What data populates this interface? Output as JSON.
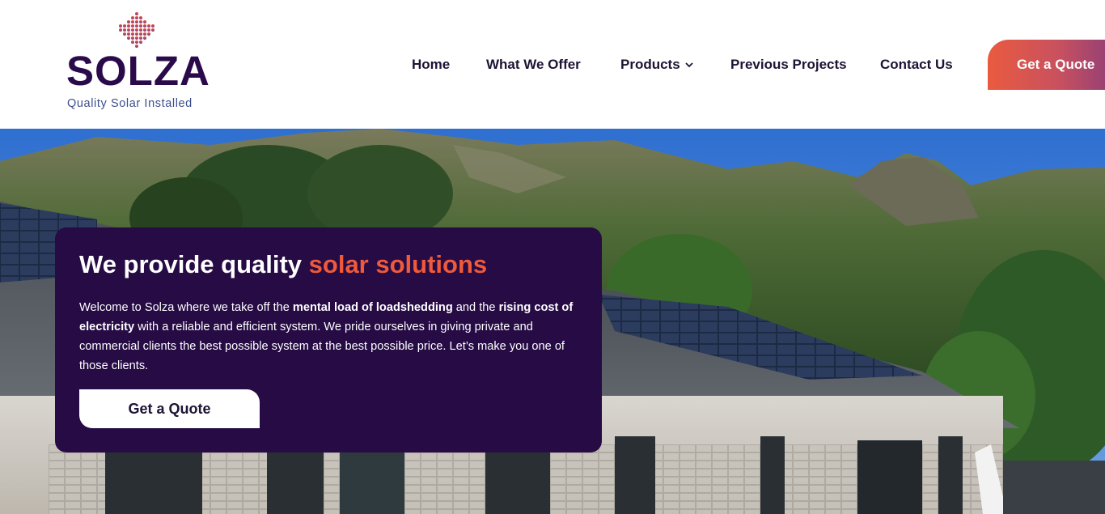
{
  "brand": {
    "name": "SOLZA",
    "tagline": "Quality Solar Installed",
    "primary_color": "#2a0a4a",
    "accent_color": "#ee5a3a"
  },
  "nav": {
    "items": [
      {
        "label": "Home"
      },
      {
        "label": "What We Offer"
      },
      {
        "label": "Products",
        "has_dropdown": true,
        "icon": "chevron-down-icon"
      },
      {
        "label": "Previous Projects"
      },
      {
        "label": "Contact Us"
      }
    ],
    "cta_label": "Get a Quote"
  },
  "hero": {
    "title_plain": "We provide quality ",
    "title_accent": "solar solutions",
    "body": {
      "p1": "Welcome to Solza where we take off the ",
      "b1": "mental load of loadshedding",
      "p2": " and the ",
      "b2": "rising cost of electricity",
      "p3": " with a reliable and efficient system. We pride ourselves in giving private and commercial clients the best possible system at the best possible price. Let’s make you one of those clients."
    },
    "cta_label": "Get a Quote",
    "background": "house-with-solar-panels-mountain-photo"
  }
}
